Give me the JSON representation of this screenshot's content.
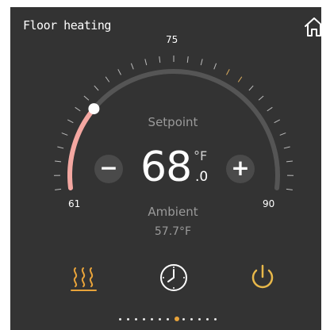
{
  "header": {
    "title": "Floor heating",
    "home_icon": "home-icon"
  },
  "dial": {
    "min_label": "61",
    "mid_label": "75",
    "max_label": "90",
    "min": 61,
    "max": 90,
    "setpoint_value": 68.0,
    "colors": {
      "active_arc": "#f4a7a1",
      "track": "#555555",
      "knob": "#ffffff",
      "tick": "#bcbcbc",
      "accent_tick": "#e0b060"
    }
  },
  "setpoint": {
    "label": "Setpoint",
    "value": "68",
    "decimal": ".0",
    "unit": "°F",
    "minus_label": "−",
    "plus_label": "+"
  },
  "ambient": {
    "label": "Ambient",
    "value": "57.7°F"
  },
  "modes": [
    {
      "name": "heat-mode",
      "icon": "heat-waves-icon",
      "color": "#e8a33a"
    },
    {
      "name": "schedule",
      "icon": "clock-icon",
      "color": "#ffffff"
    },
    {
      "name": "power",
      "icon": "power-icon",
      "color": "#e8b84a"
    }
  ],
  "pagination": {
    "count": 13,
    "active_index": 7,
    "active_color": "#e8a33a"
  }
}
